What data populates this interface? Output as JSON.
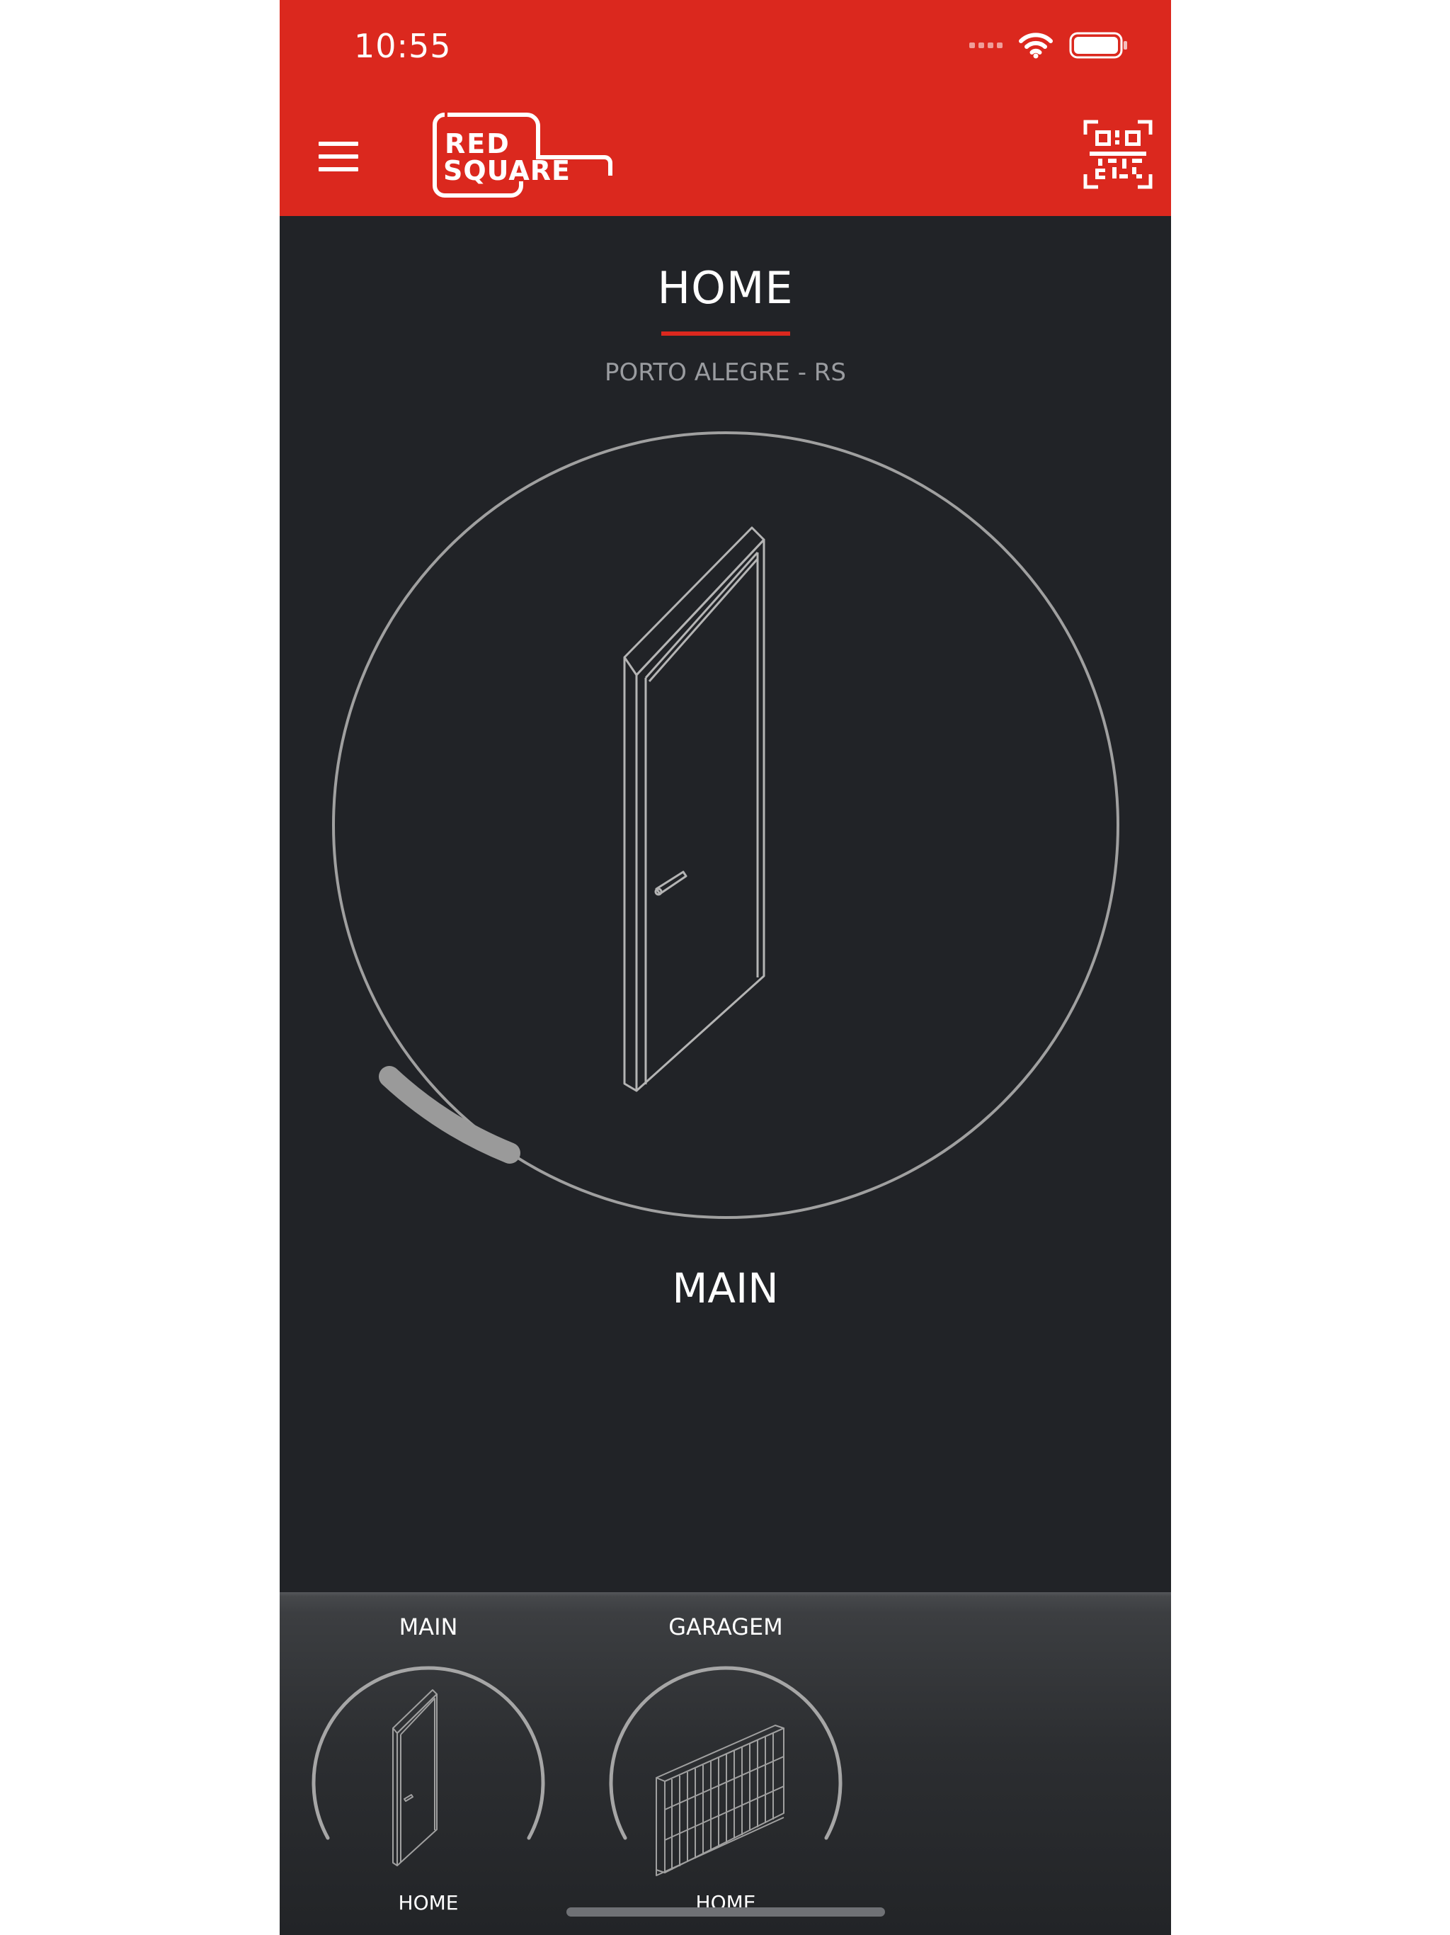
{
  "status_bar": {
    "time": "10:55"
  },
  "header": {
    "logo_line1": "RED",
    "logo_line2": "SQUARE"
  },
  "main": {
    "title": "HOME",
    "subtitle": "PORTO ALEGRE - RS",
    "selected_device": "MAIN",
    "dial_icon": "door-icon"
  },
  "devices": [
    {
      "name": "MAIN",
      "location": "HOME",
      "icon": "door-icon"
    },
    {
      "name": "GARAGEM",
      "location": "HOME",
      "icon": "garage-gate-icon"
    }
  ],
  "colors": {
    "accent": "#db281e",
    "background": "#212327",
    "line": "#a0a0a0"
  }
}
